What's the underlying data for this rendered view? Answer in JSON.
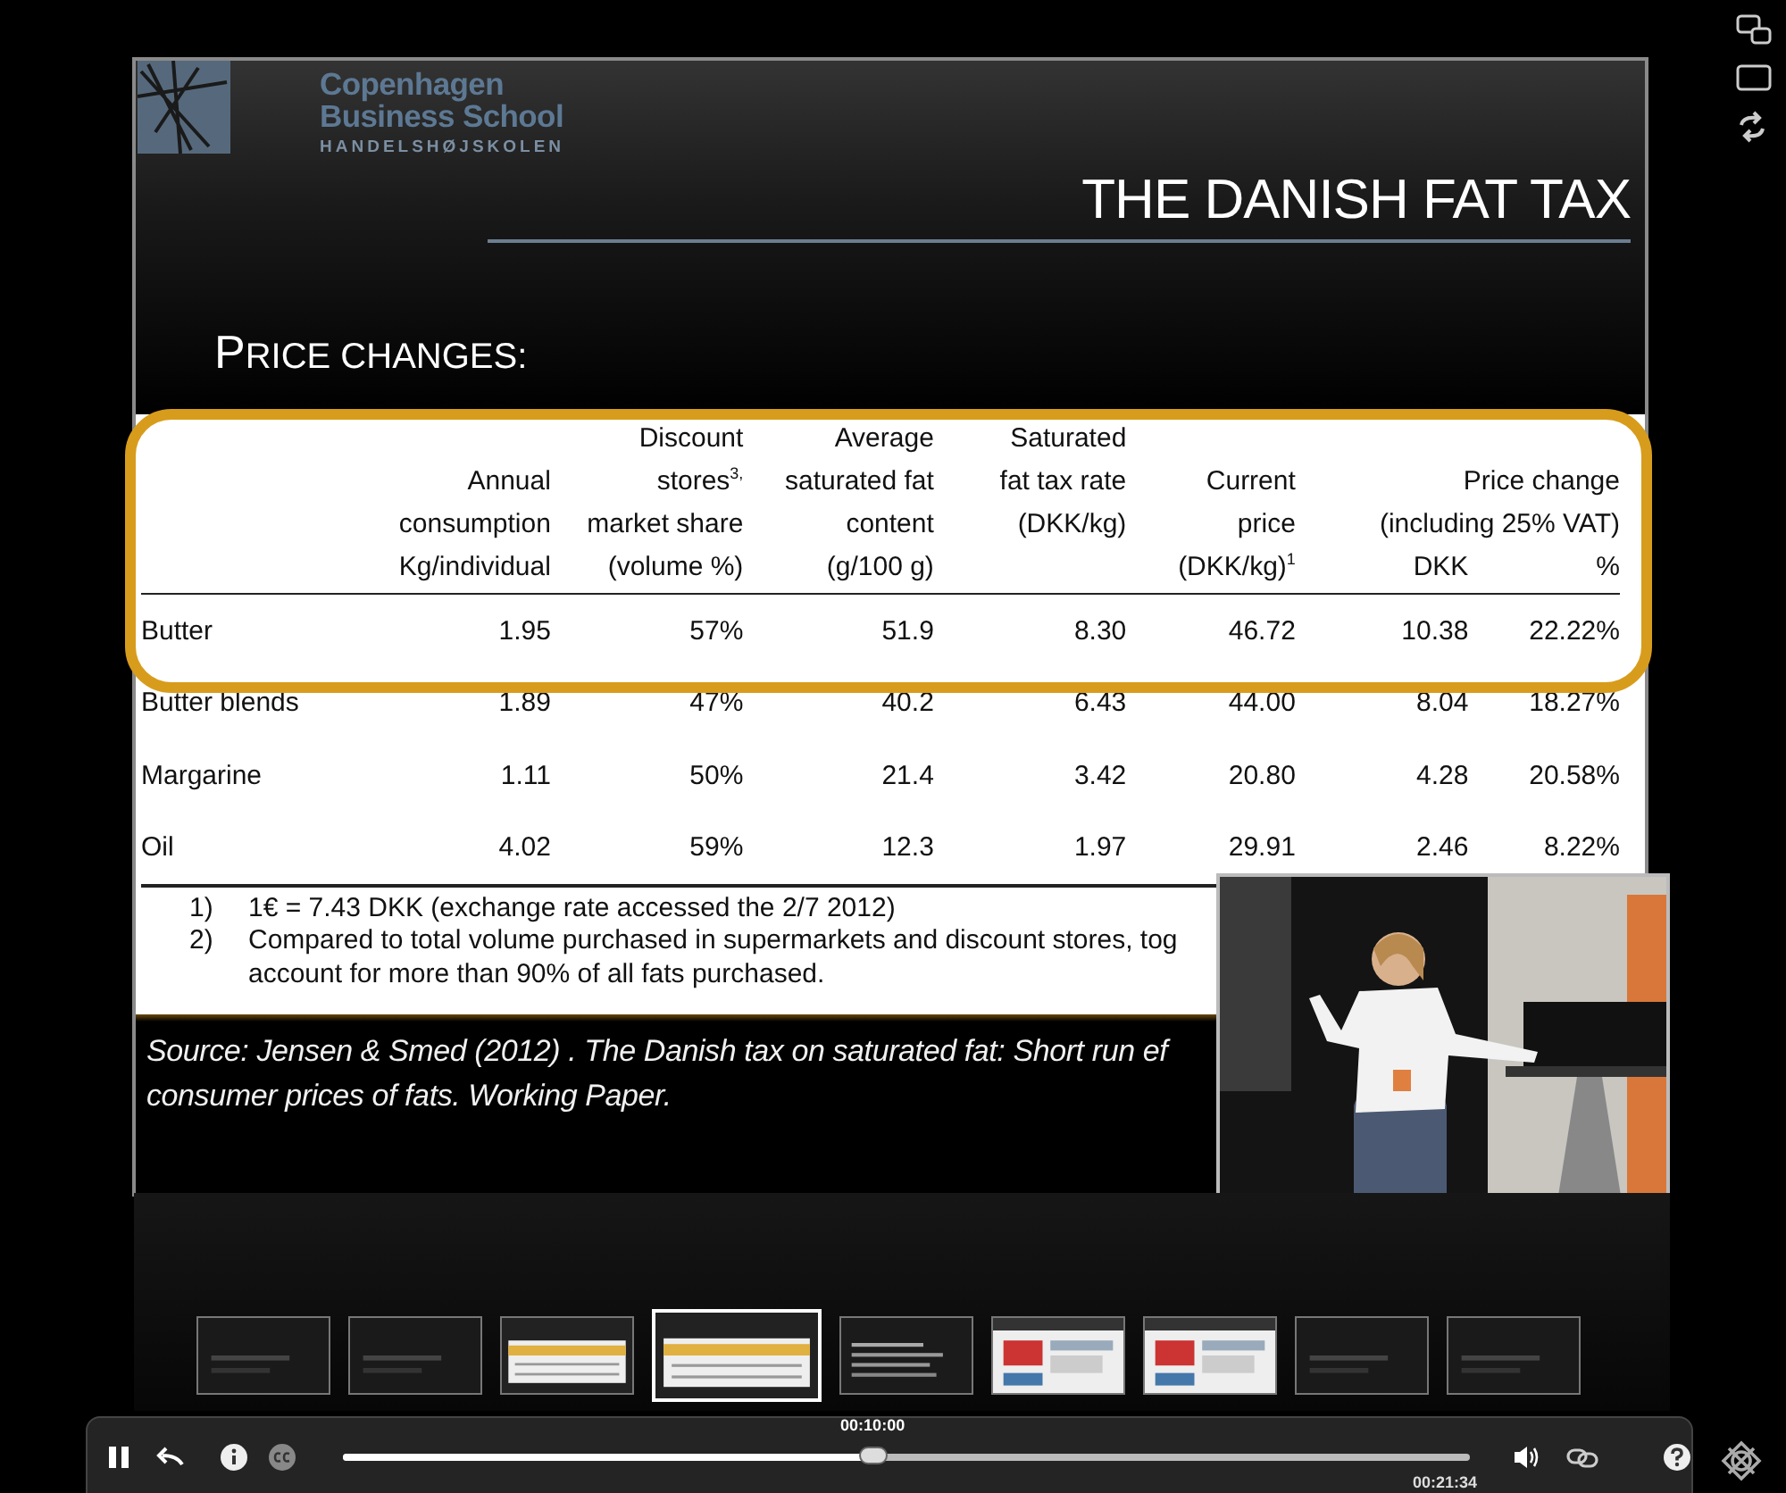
{
  "slide": {
    "logo": {
      "lines": [
        "Copenhagen",
        "Business School",
        "HANDELSHØJSKOLEN"
      ]
    },
    "title": "THE DANISH FAT TAX",
    "subtitle": "PRICE CHANGES:",
    "table": {
      "header_rows": [
        {
          "cells": [
            "",
            "",
            "Discount",
            "Average",
            "Saturated",
            "",
            "",
            ""
          ]
        },
        {
          "cells": [
            "",
            "Annual",
            "stores$^{3,}$",
            "saturated fat",
            "fat tax rate",
            "Current",
            "Price change"
          ]
        },
        {
          "cells": [
            "",
            "consumption",
            "market share",
            "content",
            "(DKK/kg)",
            "price",
            "(including 25%  VAT)"
          ]
        },
        {
          "cells": [
            "",
            "Kg/individual",
            "(volume %)",
            "(g/100 g)",
            "",
            "(DKK/kg)$^{1}$",
            "DKK",
            "%"
          ]
        }
      ],
      "rows": [
        {
          "cells": [
            "Butter",
            "1.95",
            "57%",
            "51.9",
            "8.30",
            "46.72",
            "10.38",
            "22.22%"
          ],
          "highlighted": true
        },
        {
          "cells": [
            "Butter blends",
            "1.89",
            "47%",
            "40.2",
            "6.43",
            "44.00",
            "8.04",
            "18.27%"
          ],
          "highlighted": false
        },
        {
          "cells": [
            "Margarine",
            "1.11",
            "50%",
            "21.4",
            "3.42",
            "20.80",
            "4.28",
            "20.58%"
          ],
          "highlighted": false
        },
        {
          "cells": [
            "Oil",
            "4.02",
            "59%",
            "12.3",
            "1.97",
            "29.91",
            "2.46",
            "8.22%"
          ],
          "highlighted": false
        }
      ]
    },
    "footnotes": [
      {
        "number": "1)",
        "lines": [
          "1€ = 7.43 DKK (exchange rate accessed the 2/7 2012)"
        ]
      },
      {
        "number": "2)",
        "lines": [
          "Compared to total volume purchased in supermarkets and discount stores, tog",
          "account for more than 90% of all fats purchased."
        ]
      }
    ],
    "source": {
      "lines": [
        "Source: Jensen & Smed (2012) . The Danish tax on saturated fat: Short run ef",
        "consumer prices of fats. Working Paper."
      ]
    }
  },
  "thumbnails": [
    {
      "kind": "dark",
      "selected": false
    },
    {
      "kind": "dark",
      "selected": false
    },
    {
      "kind": "table",
      "selected": false
    },
    {
      "kind": "table",
      "selected": true
    },
    {
      "kind": "text",
      "selected": false
    },
    {
      "kind": "web",
      "selected": false
    },
    {
      "kind": "web",
      "selected": false
    },
    {
      "kind": "dark",
      "selected": false
    },
    {
      "kind": "dark",
      "selected": false
    }
  ],
  "controls": {
    "playing": true,
    "progress": {
      "level": 0.47,
      "current_time": "00:10:00",
      "duration": "00:21:34"
    }
  }
}
